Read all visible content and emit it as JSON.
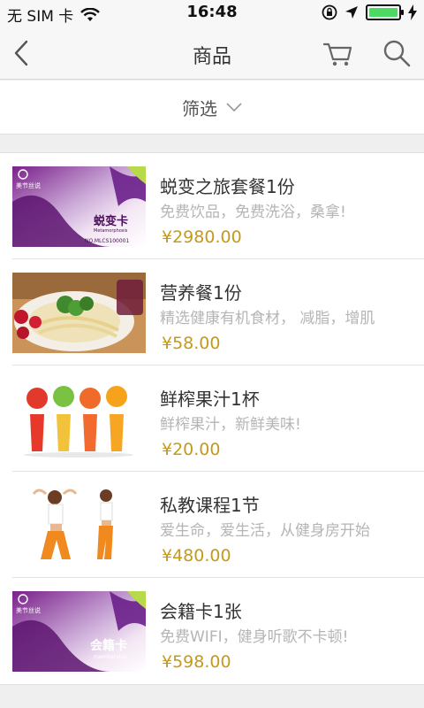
{
  "status": {
    "carrier": "无 SIM 卡",
    "time": "16:48"
  },
  "nav": {
    "title": "商品"
  },
  "filter": {
    "label": "筛选"
  },
  "colors": {
    "price": "#c49a1c",
    "battery": "#4cd964"
  },
  "products": [
    {
      "title": "蜕变之旅套餐1份",
      "desc": "免费饮品，免费洗浴，桑拿!",
      "price": "¥2980.00",
      "card_name": "蜕变卡",
      "card_sub": "Metamorphosis",
      "card_no": "NO.MLCS100001",
      "card_logo": "美节丝说"
    },
    {
      "title": "营养餐1份",
      "desc": "精选健康有机食材， 减脂，增肌",
      "price": "¥58.00"
    },
    {
      "title": "鲜榨果汁1杯",
      "desc": "鲜榨果汁，新鲜美味!",
      "price": "¥20.00"
    },
    {
      "title": "私教课程1节",
      "desc": "爱生命，爱生活，从健身房开始",
      "price": "¥480.00"
    },
    {
      "title": "会籍卡1张",
      "desc": "免费WIFI，健身听歌不卡顿!",
      "price": "¥598.00",
      "card_name": "会籍卡",
      "card_sub": "membership",
      "card_logo": "美节丝说"
    }
  ]
}
